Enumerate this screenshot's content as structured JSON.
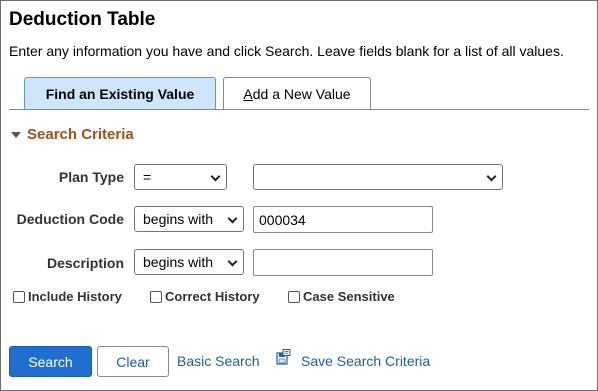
{
  "page": {
    "title": "Deduction Table",
    "instructions": "Enter any information you have and click Search. Leave fields blank for a list of all values."
  },
  "tabs": [
    {
      "label": "Find an Existing Value",
      "active": true
    },
    {
      "label": "Add a New Value",
      "active": false,
      "underline_char": "A",
      "rest": "dd a New Value"
    }
  ],
  "search_criteria": {
    "header": "Search Criteria",
    "fields": {
      "plan_type": {
        "label": "Plan Type",
        "operator": "=",
        "value": ""
      },
      "deduction_code": {
        "label": "Deduction Code",
        "operator": "begins with",
        "value": "000034"
      },
      "description": {
        "label": "Description",
        "operator": "begins with",
        "value": ""
      }
    },
    "checkboxes": [
      {
        "label": "Include History",
        "checked": false
      },
      {
        "label": "Correct History",
        "checked": false
      },
      {
        "label": "Case Sensitive",
        "checked": false
      }
    ]
  },
  "actions": {
    "search_label": "Search",
    "clear_label": "Clear",
    "basic_search_label": "Basic Search",
    "save_search_label": "Save Search Criteria",
    "save_icon": "save-search-icon"
  },
  "colors": {
    "primary_button": "#1f6fd1",
    "active_tab": "#cde6fb",
    "section_header": "#a0521b",
    "link": "#1f5fa8"
  }
}
